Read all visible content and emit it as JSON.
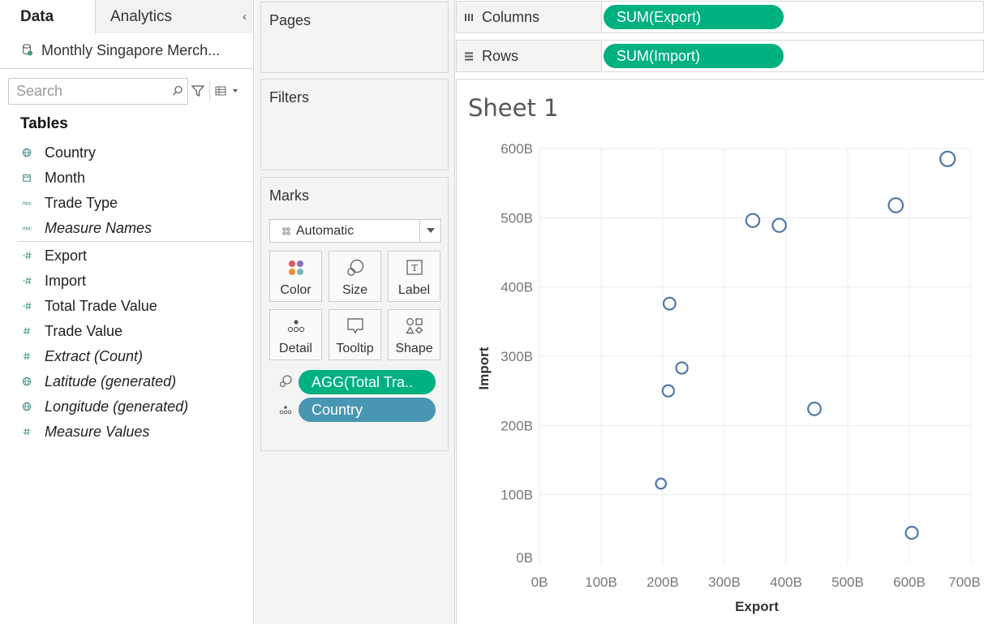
{
  "tabs": {
    "data": "Data",
    "analytics": "Analytics"
  },
  "datasource": "Monthly Singapore Merch...",
  "search": {
    "placeholder": "Search",
    "value": ""
  },
  "tables_header": "Tables",
  "dimensions": [
    {
      "label": "Country",
      "icon": "globe-icon"
    },
    {
      "label": "Month",
      "icon": "calendar-icon"
    },
    {
      "label": "Trade Type",
      "icon": "abc-icon"
    },
    {
      "label": "Measure Names",
      "icon": "abc-icon"
    }
  ],
  "measures": [
    {
      "label": "Export",
      "icon": "measure-icon"
    },
    {
      "label": "Import",
      "icon": "measure-icon"
    },
    {
      "label": "Total Trade Value",
      "icon": "measure-icon"
    },
    {
      "label": "Trade Value",
      "icon": "hash-icon"
    },
    {
      "label": "Extract (Count)",
      "icon": "hash-icon"
    },
    {
      "label": "Latitude (generated)",
      "icon": "globe-icon"
    },
    {
      "label": "Longitude (generated)",
      "icon": "globe-icon"
    },
    {
      "label": "Measure Values",
      "icon": "hash-icon"
    }
  ],
  "cards": {
    "pages": "Pages",
    "filters": "Filters",
    "marks": "Marks"
  },
  "marks": {
    "type": "Automatic",
    "buttons": [
      "Color",
      "Size",
      "Label",
      "Detail",
      "Tooltip",
      "Shape"
    ],
    "pills": [
      "AGG(Total Tra..",
      "Country"
    ]
  },
  "shelves": {
    "columns_label": "Columns",
    "columns_pill": "SUM(Export)",
    "rows_label": "Rows",
    "rows_pill": "SUM(Import)"
  },
  "colors": {
    "green_pill": "#00b180",
    "blue_pill": "#4996b2",
    "mark": "#4e79a7"
  },
  "sheet_title": "Sheet 1",
  "chart_data": {
    "type": "scatter",
    "title": "Sheet 1",
    "xlabel": "Export",
    "ylabel": "Import",
    "xlim": [
      0,
      700
    ],
    "ylim": [
      0,
      600
    ],
    "x_ticks": [
      "0B",
      "100B",
      "200B",
      "300B",
      "400B",
      "500B",
      "600B",
      "700B"
    ],
    "y_ticks": [
      "0B",
      "100B",
      "200B",
      "300B",
      "400B",
      "500B",
      "600B"
    ],
    "grid": true,
    "points": [
      {
        "x": 662,
        "y": 585,
        "size": 1.0
      },
      {
        "x": 578,
        "y": 518,
        "size": 0.95
      },
      {
        "x": 346,
        "y": 496,
        "size": 0.85
      },
      {
        "x": 389,
        "y": 489,
        "size": 0.85
      },
      {
        "x": 211,
        "y": 376,
        "size": 0.7
      },
      {
        "x": 231,
        "y": 283,
        "size": 0.65
      },
      {
        "x": 209,
        "y": 250,
        "size": 0.65
      },
      {
        "x": 446,
        "y": 224,
        "size": 0.78
      },
      {
        "x": 197,
        "y": 116,
        "size": 0.5
      },
      {
        "x": 604,
        "y": 45,
        "size": 0.72
      }
    ]
  }
}
